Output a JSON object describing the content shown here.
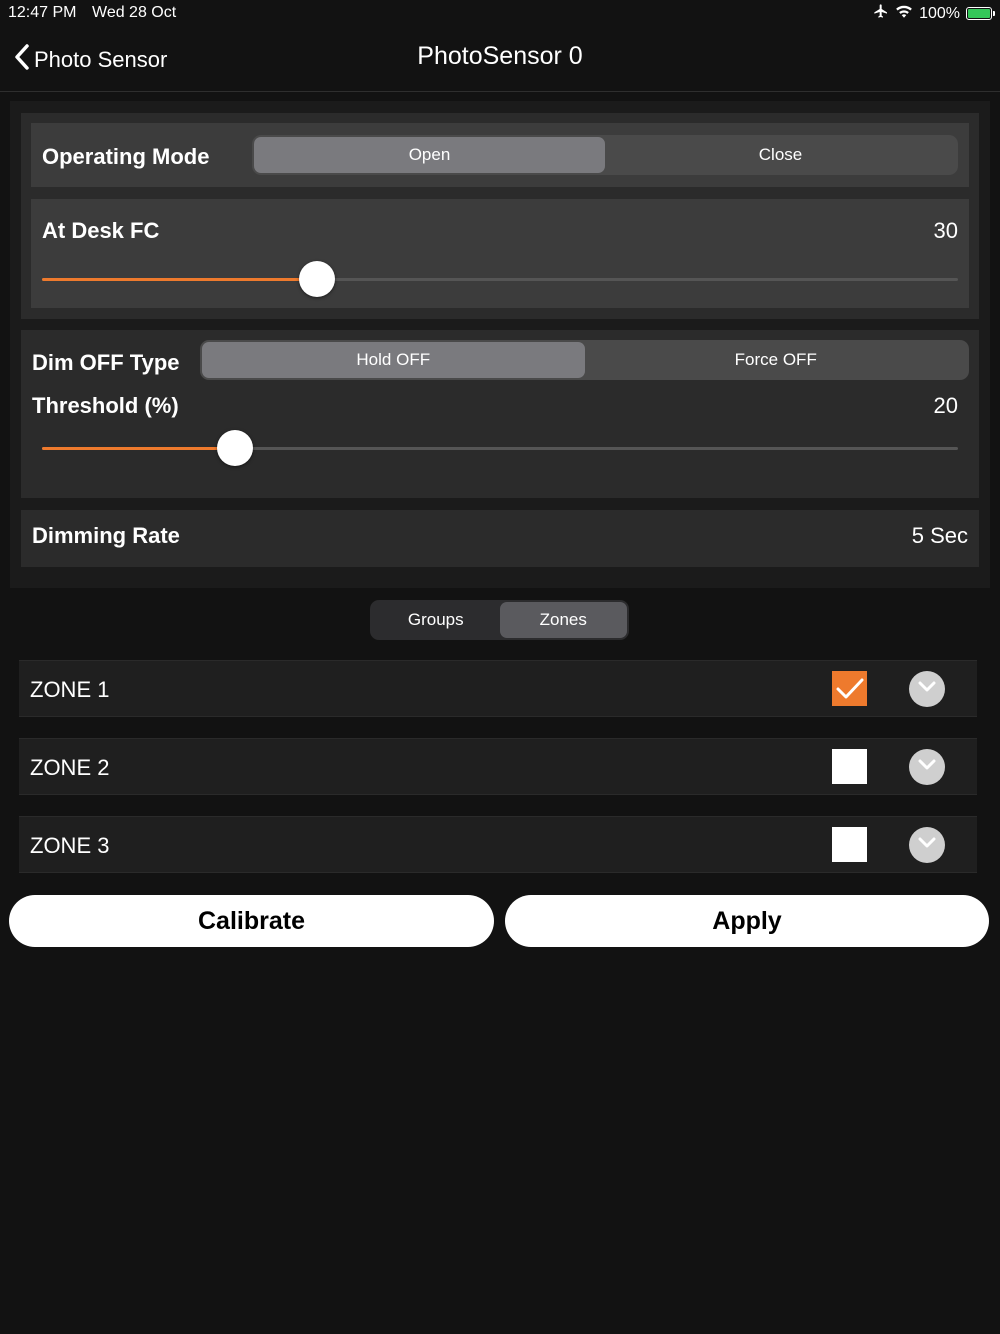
{
  "status_bar": {
    "time": "12:47 PM",
    "date": "Wed 28 Oct",
    "battery": "100%",
    "battery_level": 1.0
  },
  "nav": {
    "back_label": "Photo Sensor",
    "title": "PhotoSensor 0"
  },
  "operating_mode": {
    "label": "Operating Mode",
    "options": [
      "Open",
      "Close"
    ],
    "selected": "Open"
  },
  "at_desk_fc": {
    "label": "At Desk FC",
    "value": "30",
    "slider_fraction": 0.3
  },
  "dim_off_type": {
    "label": "Dim OFF Type",
    "options": [
      "Hold OFF",
      "Force OFF"
    ],
    "selected": "Hold OFF"
  },
  "threshold": {
    "label": "Threshold (%)",
    "value": "20",
    "slider_fraction": 0.2
  },
  "dimming_rate": {
    "label": "Dimming Rate",
    "value": "5 Sec"
  },
  "view_toggle": {
    "options": [
      "Groups",
      "Zones"
    ],
    "selected": "Zones"
  },
  "zones": [
    {
      "name": "ZONE 1",
      "checked": true
    },
    {
      "name": "ZONE 2",
      "checked": false
    },
    {
      "name": "ZONE 3",
      "checked": false
    }
  ],
  "buttons": {
    "calibrate": "Calibrate",
    "apply": "Apply"
  },
  "colors": {
    "accent": "#ee7a2d",
    "background": "#121212",
    "battery": "#34c759"
  }
}
